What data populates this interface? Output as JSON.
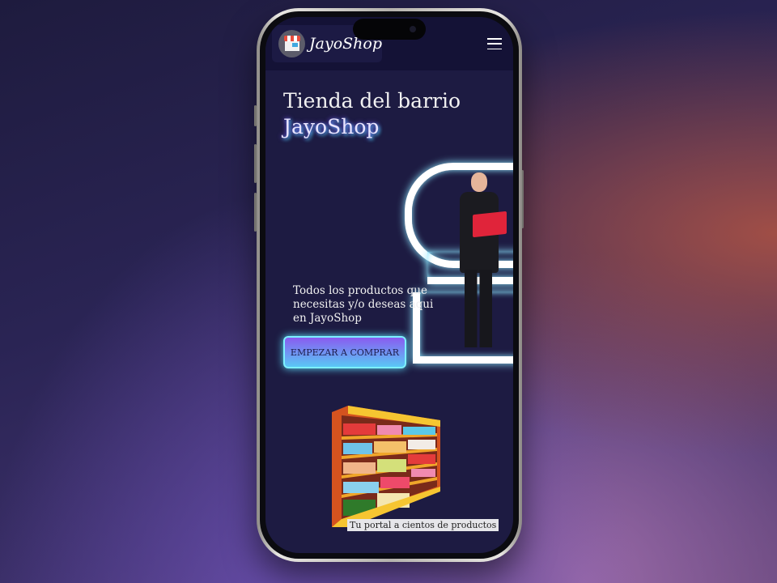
{
  "nav": {
    "brand": "JayoShop",
    "logo_icon": "store-icon",
    "menu_icon": "hamburger-menu-icon"
  },
  "hero": {
    "title_line1": "Tienda del barrio",
    "title_line2": "JayoShop",
    "description": "Todos los productos que necesitas y/o deseas aqui en JayoShop",
    "cta_label": "EMPEZAR A COMPRAR"
  },
  "products": {
    "caption": "Tu portal a cientos de productos"
  },
  "colors": {
    "accent_cyan": "#5fe3ff",
    "accent_purple": "#8a5cf0",
    "screen_bg": "#1d1b42"
  }
}
